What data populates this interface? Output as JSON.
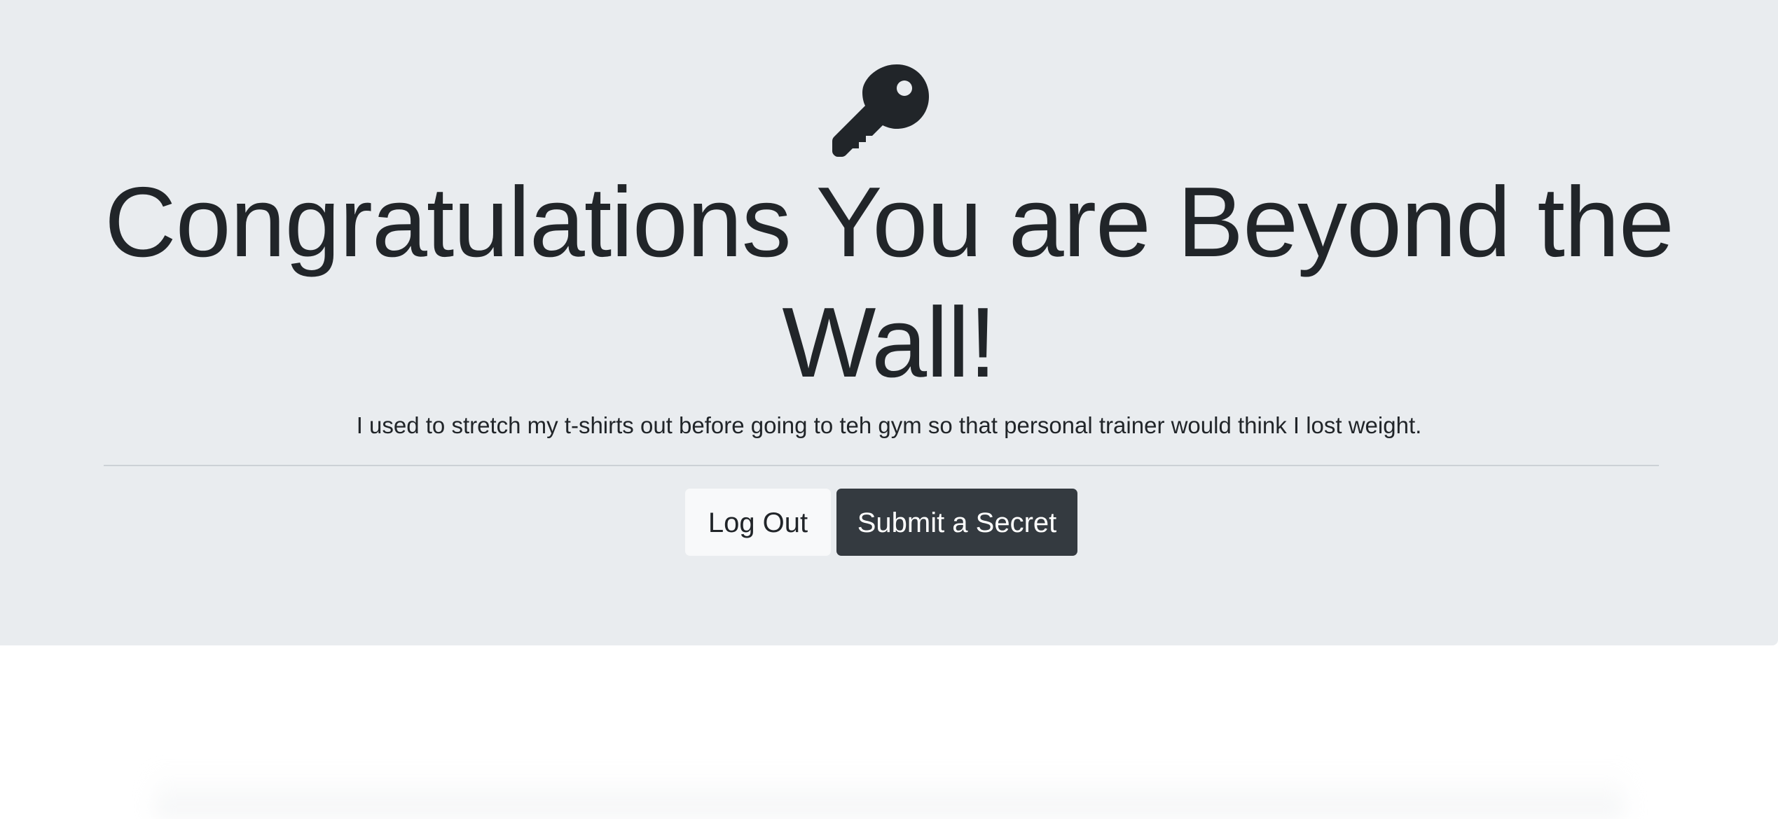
{
  "header": {
    "icon": "key-icon",
    "title": "Congratulations You are Beyond the Wall!",
    "secret_text": "I used to stretch my t-shirts out before going to teh gym so that personal trainer would think I lost weight."
  },
  "actions": {
    "logout_label": "Log Out",
    "submit_label": "Submit a Secret"
  },
  "colors": {
    "jumbotron_bg": "#e9ecef",
    "text": "#212529",
    "dark_button": "#343a40",
    "light_button": "#f8f9fa"
  }
}
